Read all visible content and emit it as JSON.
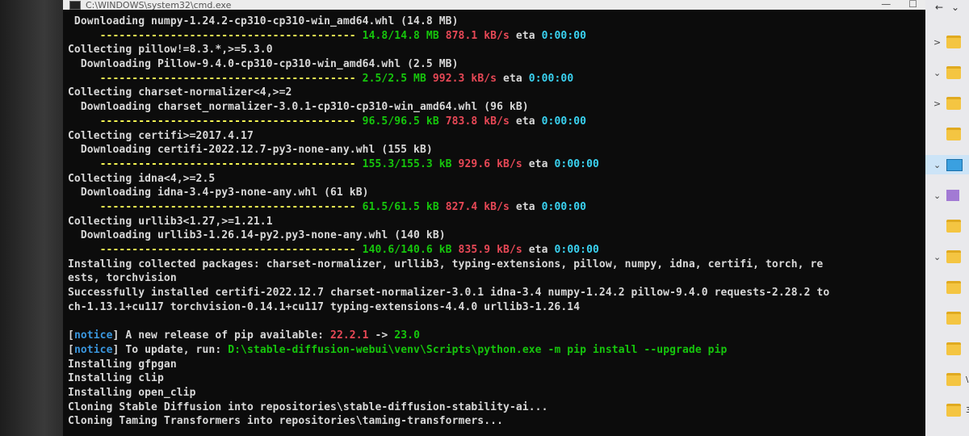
{
  "window": {
    "title": "C:\\WINDOWS\\system32\\cmd.exe",
    "controls": [
      "—",
      "☐"
    ]
  },
  "terminal": {
    "lines": [
      [
        {
          "t": " Downloading numpy-1.24.2-cp310-cp310-win_amd64.whl (14.8 MB)",
          "c": "w"
        }
      ],
      [
        {
          "t": "     ---------------------------------------- ",
          "c": "y"
        },
        {
          "t": "14.8/14.8 MB ",
          "c": "g"
        },
        {
          "t": "878.1 kB/s ",
          "c": "r"
        },
        {
          "t": "eta ",
          "c": "w"
        },
        {
          "t": "0:00:00",
          "c": "c"
        }
      ],
      [
        {
          "t": "Collecting pillow!=8.3.*,>=5.3.0",
          "c": "w"
        }
      ],
      [
        {
          "t": "  Downloading Pillow-9.4.0-cp310-cp310-win_amd64.whl (2.5 MB)",
          "c": "w"
        }
      ],
      [
        {
          "t": "     ---------------------------------------- ",
          "c": "y"
        },
        {
          "t": "2.5/2.5 MB ",
          "c": "g"
        },
        {
          "t": "992.3 kB/s ",
          "c": "r"
        },
        {
          "t": "eta ",
          "c": "w"
        },
        {
          "t": "0:00:00",
          "c": "c"
        }
      ],
      [
        {
          "t": "Collecting charset-normalizer<4,>=2",
          "c": "w"
        }
      ],
      [
        {
          "t": "  Downloading charset_normalizer-3.0.1-cp310-cp310-win_amd64.whl (96 kB)",
          "c": "w"
        }
      ],
      [
        {
          "t": "     ---------------------------------------- ",
          "c": "y"
        },
        {
          "t": "96.5/96.5 kB ",
          "c": "g"
        },
        {
          "t": "783.8 kB/s ",
          "c": "r"
        },
        {
          "t": "eta ",
          "c": "w"
        },
        {
          "t": "0:00:00",
          "c": "c"
        }
      ],
      [
        {
          "t": "Collecting certifi>=2017.4.17",
          "c": "w"
        }
      ],
      [
        {
          "t": "  Downloading certifi-2022.12.7-py3-none-any.whl (155 kB)",
          "c": "w"
        }
      ],
      [
        {
          "t": "     ---------------------------------------- ",
          "c": "y"
        },
        {
          "t": "155.3/155.3 kB ",
          "c": "g"
        },
        {
          "t": "929.6 kB/s ",
          "c": "r"
        },
        {
          "t": "eta ",
          "c": "w"
        },
        {
          "t": "0:00:00",
          "c": "c"
        }
      ],
      [
        {
          "t": "Collecting idna<4,>=2.5",
          "c": "w"
        }
      ],
      [
        {
          "t": "  Downloading idna-3.4-py3-none-any.whl (61 kB)",
          "c": "w"
        }
      ],
      [
        {
          "t": "     ---------------------------------------- ",
          "c": "y"
        },
        {
          "t": "61.5/61.5 kB ",
          "c": "g"
        },
        {
          "t": "827.4 kB/s ",
          "c": "r"
        },
        {
          "t": "eta ",
          "c": "w"
        },
        {
          "t": "0:00:00",
          "c": "c"
        }
      ],
      [
        {
          "t": "Collecting urllib3<1.27,>=1.21.1",
          "c": "w"
        }
      ],
      [
        {
          "t": "  Downloading urllib3-1.26.14-py2.py3-none-any.whl (140 kB)",
          "c": "w"
        }
      ],
      [
        {
          "t": "     ---------------------------------------- ",
          "c": "y"
        },
        {
          "t": "140.6/140.6 kB ",
          "c": "g"
        },
        {
          "t": "835.9 kB/s ",
          "c": "r"
        },
        {
          "t": "eta ",
          "c": "w"
        },
        {
          "t": "0:00:00",
          "c": "c"
        }
      ],
      [
        {
          "t": "Installing collected packages: charset-normalizer, urllib3, typing-extensions, pillow, numpy, idna, certifi, torch, re",
          "c": "w"
        }
      ],
      [
        {
          "t": "ests, torchvision",
          "c": "w"
        }
      ],
      [
        {
          "t": "Successfully installed certifi-2022.12.7 charset-normalizer-3.0.1 idna-3.4 numpy-1.24.2 pillow-9.4.0 requests-2.28.2 to",
          "c": "w"
        }
      ],
      [
        {
          "t": "ch-1.13.1+cu117 torchvision-0.14.1+cu117 typing-extensions-4.4.0 urllib3-1.26.14",
          "c": "w"
        }
      ],
      [
        {
          "t": "",
          "c": "w"
        }
      ],
      [
        {
          "t": "[",
          "c": "w"
        },
        {
          "t": "notice",
          "c": "notice"
        },
        {
          "t": "] A new release of pip available: ",
          "c": "w"
        },
        {
          "t": "22.2.1",
          "c": "r"
        },
        {
          "t": " -> ",
          "c": "w"
        },
        {
          "t": "23.0",
          "c": "g"
        }
      ],
      [
        {
          "t": "[",
          "c": "w"
        },
        {
          "t": "notice",
          "c": "notice"
        },
        {
          "t": "] To update, run: ",
          "c": "w"
        },
        {
          "t": "D:\\stable-diffusion-webui\\venv\\Scripts\\python.exe -m pip install --upgrade pip",
          "c": "g"
        }
      ],
      [
        {
          "t": "Installing gfpgan",
          "c": "w"
        }
      ],
      [
        {
          "t": "Installing clip",
          "c": "w"
        }
      ],
      [
        {
          "t": "Installing open_clip",
          "c": "w"
        }
      ],
      [
        {
          "t": "Cloning Stable Diffusion into repositories\\stable-diffusion-stability-ai...",
          "c": "w"
        }
      ],
      [
        {
          "t": "Cloning Taming Transformers into repositories\\taming-transformers...",
          "c": "w"
        }
      ]
    ]
  },
  "side_panel": {
    "top_icons": [
      "←",
      "⌄"
    ],
    "rows": [
      {
        "chev": ">",
        "icon": "folder",
        "label": "",
        "selected": false
      },
      {
        "chev": "⌄",
        "icon": "folder",
        "label": "",
        "selected": false
      },
      {
        "chev": ">",
        "icon": "folder",
        "label": "",
        "selected": false
      },
      {
        "chev": "",
        "icon": "folder",
        "label": "",
        "selected": false
      },
      {
        "chev": "⌄",
        "icon": "pc",
        "label": "",
        "selected": true
      },
      {
        "chev": "⌄",
        "icon": "purple",
        "label": "",
        "selected": false
      },
      {
        "chev": "",
        "icon": "folder",
        "label": "",
        "selected": false
      },
      {
        "chev": "⌄",
        "icon": "folder",
        "label": "",
        "selected": false
      },
      {
        "chev": "",
        "icon": "folder",
        "label": "",
        "selected": false
      },
      {
        "chev": "",
        "icon": "folder",
        "label": "",
        "selected": false
      },
      {
        "chev": "",
        "icon": "folder",
        "label": "",
        "selected": false
      },
      {
        "chev": "",
        "icon": "folder",
        "label": "\\",
        "selected": false
      },
      {
        "chev": "",
        "icon": "folder",
        "label": "3",
        "selected": false
      }
    ]
  }
}
